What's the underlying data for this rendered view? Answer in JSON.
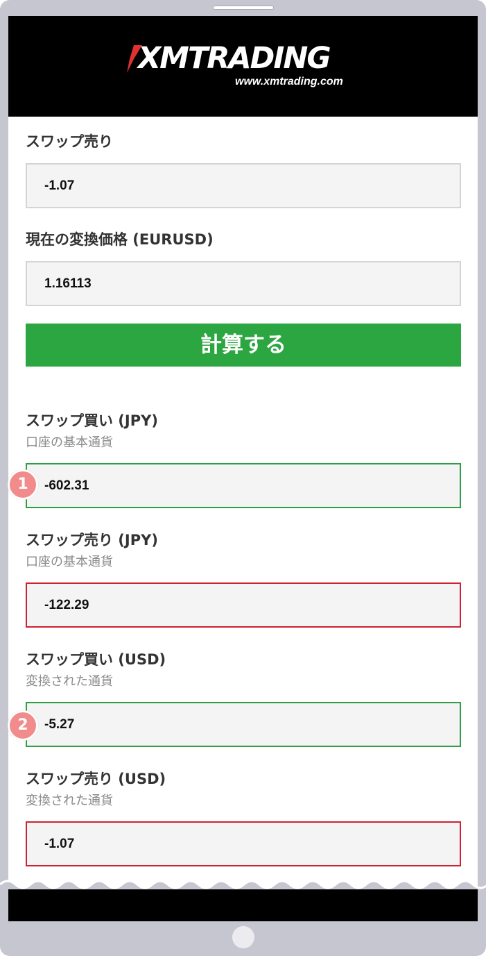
{
  "header": {
    "logo_text": "XMTRADING",
    "logo_url": "www.xmtrading.com",
    "brand_colors": {
      "background": "#000000",
      "accent": "#e03030"
    }
  },
  "inputs": {
    "swap_sell_label": "スワップ売り",
    "swap_sell_value": "-1.07",
    "rate_label": "現在の変換価格 (EURUSD)",
    "rate_value": "1.16113"
  },
  "calc_button_label": "計算する",
  "results": [
    {
      "label": "スワップ買い (JPY)",
      "sublabel": "口座の基本通貨",
      "value": "-602.31",
      "status_color": "#2f9e44",
      "badge": "1"
    },
    {
      "label": "スワップ売り (JPY)",
      "sublabel": "口座の基本通貨",
      "value": "-122.29",
      "status_color": "#cc2233",
      "badge": ""
    },
    {
      "label": "スワップ買い (USD)",
      "sublabel": "変換された通貨",
      "value": "-5.27",
      "status_color": "#2f9e44",
      "badge": "2"
    },
    {
      "label": "スワップ売り (USD)",
      "sublabel": "変換された通貨",
      "value": "-1.07",
      "status_color": "#cc2233",
      "badge": ""
    }
  ],
  "icons": {
    "logo_mark": "xm-chevron-icon",
    "badge_shape": "circle-number"
  }
}
